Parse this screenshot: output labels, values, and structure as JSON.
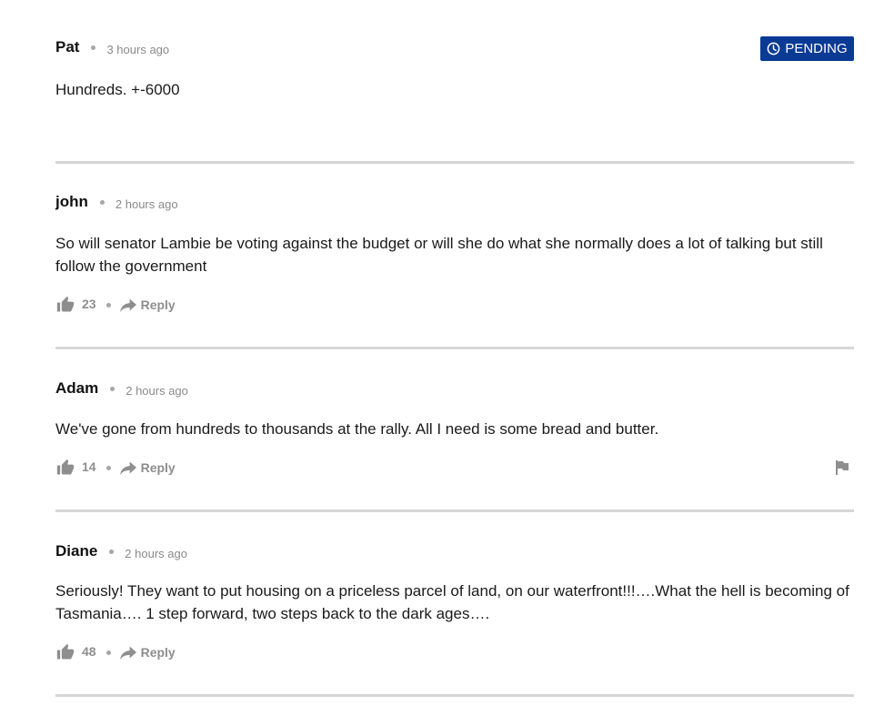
{
  "comments": [
    {
      "author": "Pat",
      "time": "3 hours ago",
      "status": "PENDING",
      "body": "Hundreds. +-6000"
    },
    {
      "author": "john",
      "time": "2 hours ago",
      "body": "So will senator Lambie be voting against the budget or will she do what she normally does a lot of talking but still follow the government",
      "likes": "23",
      "reply_label": "Reply"
    },
    {
      "author": "Adam",
      "time": "2 hours ago",
      "body": "We've gone from hundreds to thousands at the rally. All I need is some bread and butter.",
      "likes": "14",
      "reply_label": "Reply",
      "flag_icon": "flag-icon"
    },
    {
      "author": "Diane",
      "time": "2 hours ago",
      "body": "Seriously! They want to put housing on a priceless parcel of land, on our waterfront!!!….What the hell is becoming of Tasmania…. 1 step forward, two steps back to the dark ages….",
      "likes": "48",
      "reply_label": "Reply"
    }
  ],
  "colors": {
    "pending_badge": "#0a3a94",
    "divider": "#d6d6d6",
    "muted_text": "#8e8e8e"
  },
  "icons": {
    "like": "thumbs-up-icon",
    "reply": "reply-arrow-icon",
    "report": "flag-icon",
    "pending": "clock-icon"
  }
}
